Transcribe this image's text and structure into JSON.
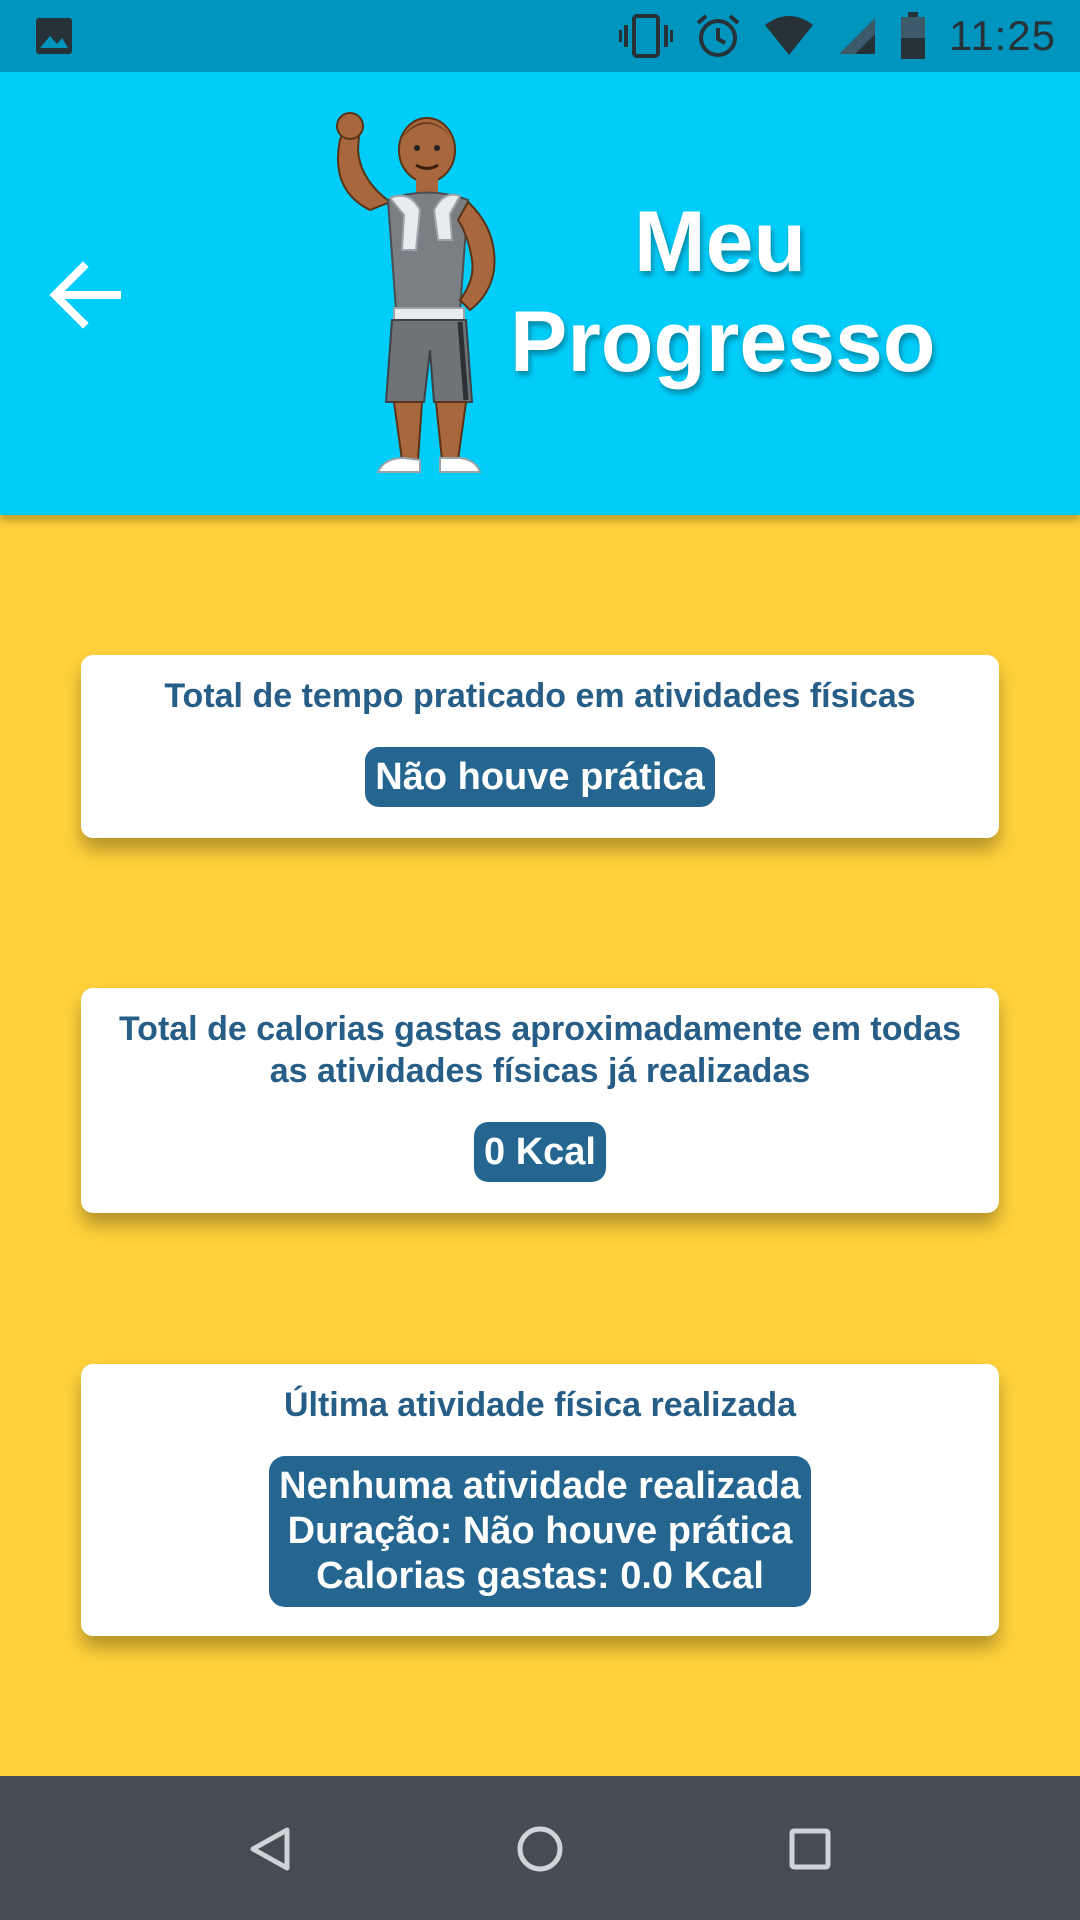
{
  "status_bar": {
    "time": "11:25",
    "icons": [
      "image-icon",
      "vibrate-icon",
      "alarm-icon",
      "wifi-icon",
      "signal-icon",
      "battery-icon"
    ]
  },
  "header": {
    "title_line1": "Meu",
    "title_line2": "Progresso",
    "back_icon": "arrow-left-icon",
    "mascot": "fitness-man-illustration"
  },
  "cards": [
    {
      "title": "Total de tempo praticado em atividades físicas",
      "value": "Não houve prática"
    },
    {
      "title": "Total de calorias gastas aproximadamente em todas as atividades físicas já realizadas",
      "value": "0 Kcal"
    },
    {
      "title": "Última atividade física realizada",
      "lines": [
        "Nenhuma atividade realizada",
        "Duração: Não houve prática",
        "Calorias gastas: 0.0 Kcal"
      ]
    }
  ],
  "nav_bar": {
    "icons": [
      "nav-back-icon",
      "nav-home-icon",
      "nav-recent-apps-icon"
    ]
  },
  "colors": {
    "status_bar": "#0095BE",
    "header": "#00CDFA",
    "background": "#FFD23B",
    "card_title": "#275E87",
    "badge": "#256691",
    "nav_bar": "#454C52"
  }
}
